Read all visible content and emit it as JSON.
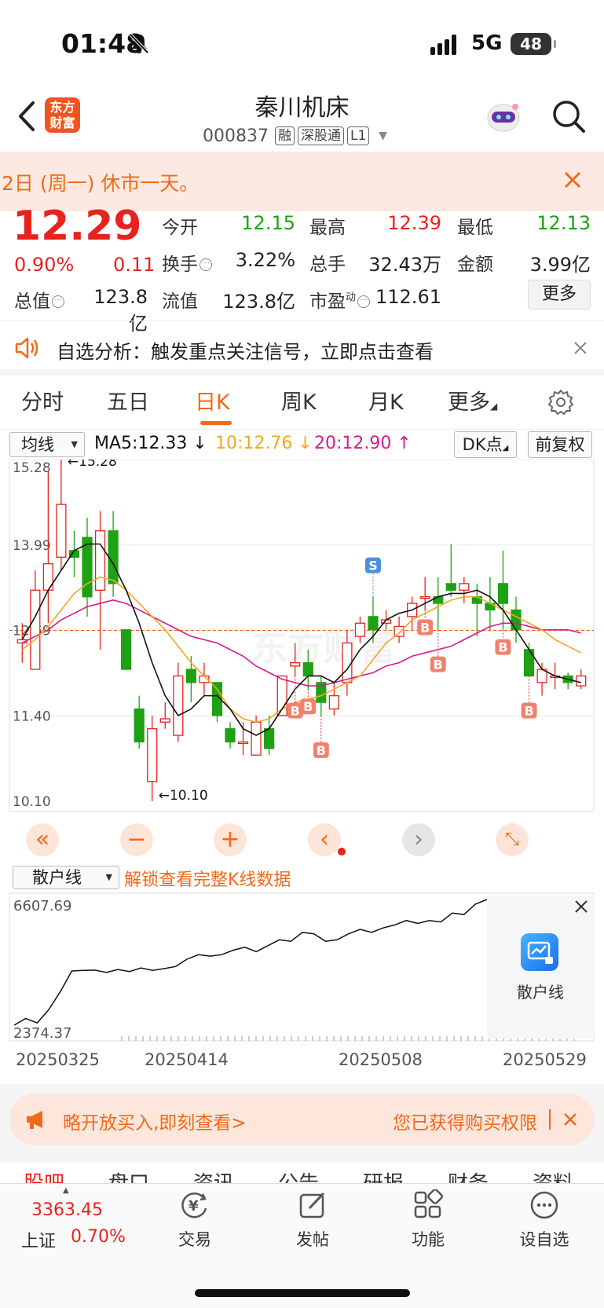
{
  "status_bar": {
    "time": "01:48",
    "network": "5G",
    "battery": "48"
  },
  "header": {
    "title": "秦川机床",
    "code": "000837",
    "tags": [
      "融",
      "深股通",
      "L1"
    ],
    "logo": "东方财富"
  },
  "notice": {
    "text": "2日 (周一) 休市一天。"
  },
  "quote": {
    "price": "12.29",
    "change_pct": "0.90%",
    "change_amt": "0.11",
    "open_label": "今开",
    "open": "12.15",
    "high_label": "最高",
    "high": "12.39",
    "low_label": "最低",
    "low": "12.13",
    "turnover_label": "换手",
    "turnover": "3.22%",
    "volume_label": "总手",
    "volume": "32.43万",
    "amount_label": "金额",
    "amount": "3.99亿",
    "mktcap_label": "总值",
    "mktcap": "123.8亿",
    "float_label": "流值",
    "float": "123.8亿",
    "pe_label": "市盈",
    "pe_sup": "动",
    "pe": "112.61",
    "more": "更多"
  },
  "analysis": {
    "text": "自选分析：触发重点关注信号，立即点击查看"
  },
  "chart_tabs": [
    "分时",
    "五日",
    "日K",
    "周K",
    "月K",
    "更多"
  ],
  "active_tab": "日K",
  "ma_row": {
    "select": "均线",
    "ma5": "MA5:12.33",
    "ma10": "10:12.76",
    "ma20": "20:12.90",
    "dk": "DK点",
    "adjust": "前复权"
  },
  "colors": {
    "up": "#e8221c",
    "down": "#1ea114",
    "accent": "#f06a1a",
    "ma5": "#111111",
    "ma10": "#f5a623",
    "ma20": "#d8198c"
  },
  "chart_data": {
    "type": "candlestick",
    "y_labels": [
      "15.28",
      "13.99",
      "12.69",
      "11.40",
      "10.10"
    ],
    "ylim": [
      10.1,
      15.28
    ],
    "max_annotation": "←15.28",
    "min_annotation": "←10.10",
    "reference_price": 12.69,
    "candles": [
      {
        "o": 12.5,
        "c": 12.55,
        "h": 12.8,
        "l": 12.2
      },
      {
        "o": 12.1,
        "c": 13.3,
        "h": 13.6,
        "l": 12.1
      },
      {
        "o": 13.3,
        "c": 13.7,
        "h": 15.1,
        "l": 12.8
      },
      {
        "o": 13.8,
        "c": 14.6,
        "h": 15.28,
        "l": 13.6
      },
      {
        "o": 13.9,
        "c": 13.8,
        "h": 14.2,
        "l": 13.5
      },
      {
        "o": 14.1,
        "c": 13.2,
        "h": 14.4,
        "l": 12.9
      },
      {
        "o": 13.3,
        "c": 14.2,
        "h": 14.5,
        "l": 12.4
      },
      {
        "o": 14.2,
        "c": 13.4,
        "h": 14.5,
        "l": 13.2
      },
      {
        "o": 12.7,
        "c": 12.1,
        "h": 12.7,
        "l": 12.1
      },
      {
        "o": 11.5,
        "c": 11.0,
        "h": 11.7,
        "l": 10.9
      },
      {
        "o": 10.4,
        "c": 11.2,
        "h": 11.4,
        "l": 10.1
      },
      {
        "o": 11.3,
        "c": 11.35,
        "h": 11.6,
        "l": 11.2
      },
      {
        "o": 11.1,
        "c": 12.0,
        "h": 12.2,
        "l": 11.0
      },
      {
        "o": 12.1,
        "c": 11.9,
        "h": 12.3,
        "l": 11.6
      },
      {
        "o": 11.9,
        "c": 12.0,
        "h": 12.2,
        "l": 11.7
      },
      {
        "o": 11.9,
        "c": 11.4,
        "h": 11.9,
        "l": 11.3
      },
      {
        "o": 11.2,
        "c": 11.0,
        "h": 11.3,
        "l": 10.9
      },
      {
        "o": 11.0,
        "c": 11.0,
        "h": 11.3,
        "l": 10.8
      },
      {
        "o": 10.8,
        "c": 11.3,
        "h": 11.4,
        "l": 10.8
      },
      {
        "o": 11.2,
        "c": 10.9,
        "h": 11.4,
        "l": 10.8
      },
      {
        "o": 11.4,
        "c": 12.0,
        "h": 12.0,
        "l": 11.4
      },
      {
        "o": 12.15,
        "c": 12.2,
        "h": 12.5,
        "l": 12.0
      },
      {
        "o": 12.2,
        "c": 12.0,
        "h": 12.4,
        "l": 11.8
      },
      {
        "o": 11.9,
        "c": 11.6,
        "h": 12.0,
        "l": 11.4
      },
      {
        "o": 11.5,
        "c": 11.7,
        "h": 11.9,
        "l": 11.4
      },
      {
        "o": 11.9,
        "c": 12.5,
        "h": 12.7,
        "l": 11.7
      },
      {
        "o": 12.6,
        "c": 12.8,
        "h": 12.9,
        "l": 12.5
      },
      {
        "o": 12.9,
        "c": 12.7,
        "h": 13.2,
        "l": 12.5
      },
      {
        "o": 12.8,
        "c": 12.85,
        "h": 13.0,
        "l": 12.7
      },
      {
        "o": 12.6,
        "c": 12.75,
        "h": 12.9,
        "l": 12.5
      },
      {
        "o": 12.9,
        "c": 13.1,
        "h": 13.2,
        "l": 12.7
      },
      {
        "o": 13.2,
        "c": 13.2,
        "h": 13.5,
        "l": 13.0
      },
      {
        "o": 13.2,
        "c": 13.1,
        "h": 13.5,
        "l": 12.7
      },
      {
        "o": 13.4,
        "c": 13.3,
        "h": 14.0,
        "l": 13.2
      },
      {
        "o": 13.3,
        "c": 13.4,
        "h": 13.5,
        "l": 13.1
      },
      {
        "o": 13.2,
        "c": 13.1,
        "h": 13.4,
        "l": 12.6
      },
      {
        "o": 13.1,
        "c": 13.0,
        "h": 13.5,
        "l": 12.7
      },
      {
        "o": 13.4,
        "c": 13.1,
        "h": 13.9,
        "l": 12.7
      },
      {
        "o": 13.0,
        "c": 12.7,
        "h": 13.2,
        "l": 12.5
      },
      {
        "o": 12.4,
        "c": 12.0,
        "h": 12.5,
        "l": 12.0
      },
      {
        "o": 11.9,
        "c": 12.1,
        "h": 12.2,
        "l": 11.7
      },
      {
        "o": 12.0,
        "c": 12.0,
        "h": 12.2,
        "l": 11.8
      },
      {
        "o": 12.0,
        "c": 11.9,
        "h": 12.05,
        "l": 11.8
      },
      {
        "o": 11.85,
        "c": 12.0,
        "h": 12.1,
        "l": 11.8
      }
    ],
    "ma5": [
      12.55,
      12.9,
      13.3,
      13.6,
      13.9,
      14.0,
      14.0,
      13.7,
      13.3,
      12.8,
      12.2,
      11.7,
      11.4,
      11.5,
      11.7,
      11.7,
      11.5,
      11.2,
      11.1,
      11.2,
      11.5,
      11.8,
      12.0,
      12.0,
      11.9,
      12.1,
      12.4,
      12.6,
      12.85,
      12.95,
      13.0,
      13.1,
      13.2,
      13.25,
      13.25,
      13.3,
      13.2,
      13.0,
      12.7,
      12.4,
      12.1,
      12.0,
      11.95,
      11.9
    ],
    "ma10": [
      12.4,
      12.55,
      12.75,
      13.0,
      13.25,
      13.4,
      13.5,
      13.45,
      13.3,
      13.1,
      12.9,
      12.7,
      12.45,
      12.2,
      12.0,
      11.8,
      11.5,
      11.35,
      11.3,
      11.35,
      11.5,
      11.6,
      11.65,
      11.7,
      11.8,
      11.9,
      12.0,
      12.25,
      12.5,
      12.65,
      12.85,
      12.95,
      13.05,
      13.15,
      13.2,
      13.2,
      13.1,
      13.0,
      12.9,
      12.8,
      12.7,
      12.55,
      12.45,
      12.35
    ],
    "ma20": [
      12.5,
      12.6,
      12.7,
      12.85,
      12.95,
      13.05,
      13.1,
      13.15,
      13.1,
      13.0,
      12.9,
      12.8,
      12.7,
      12.6,
      12.55,
      12.5,
      12.4,
      12.3,
      12.15,
      12.05,
      11.95,
      11.9,
      11.85,
      11.85,
      11.9,
      11.95,
      12.0,
      12.05,
      12.15,
      12.2,
      12.3,
      12.35,
      12.4,
      12.45,
      12.55,
      12.65,
      12.75,
      12.8,
      12.8,
      12.75,
      12.7,
      12.7,
      12.7,
      12.65
    ],
    "signals": [
      {
        "label": "S",
        "index": 27
      },
      {
        "label": "B",
        "index": 21
      },
      {
        "label": "B",
        "index": 22
      },
      {
        "label": "B",
        "index": 23
      },
      {
        "label": "B",
        "index": 31
      },
      {
        "label": "B",
        "index": 32
      },
      {
        "label": "B",
        "index": 37
      },
      {
        "label": "B",
        "index": 39
      }
    ]
  },
  "sanhu": {
    "select": "散户线",
    "unlock": "解锁查看完整K线数据",
    "max_label": "6607.69",
    "min_label": "2374.37",
    "panel_label": "散户线",
    "values": [
      2374,
      2600,
      2450,
      2900,
      3500,
      4200,
      4220,
      4230,
      4150,
      4250,
      4180,
      4300,
      4220,
      4280,
      4350,
      4600,
      4750,
      4700,
      4750,
      4900,
      5000,
      4850,
      5050,
      5250,
      5200,
      5500,
      5450,
      5200,
      5250,
      5450,
      5600,
      5500,
      5650,
      5750,
      5900,
      5800,
      5900,
      5850,
      6150,
      6100,
      6450,
      6607
    ]
  },
  "dates": [
    "20250325",
    "20250414",
    "20250508",
    "20250529"
  ],
  "promo": {
    "left": "略开放买入,即刻查看>",
    "right": "您已获得购买权限"
  },
  "sub_tabs": [
    "股吧",
    "盘口",
    "资讯",
    "公告",
    "研报",
    "财务",
    "资料"
  ],
  "bottom_bar": {
    "index_value": "3363.45",
    "index_name": "上证",
    "index_pct": "0.70%",
    "items": [
      "交易",
      "发帖",
      "功能",
      "设自选"
    ]
  }
}
